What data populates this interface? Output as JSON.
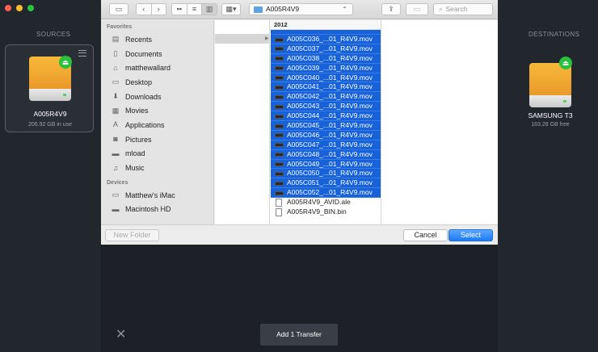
{
  "sources": {
    "title": "SOURCES",
    "volume": {
      "name": "A005R4V9",
      "size": "206.92 GB in use"
    }
  },
  "destinations": {
    "title": "DESTINATIONS",
    "volume": {
      "name": "SAMSUNG T3",
      "size": "163.28 GB free"
    }
  },
  "dialog": {
    "path": "A005R4V9",
    "search_placeholder": "Search",
    "sidebar": {
      "favorites_header": "Favorites",
      "favorites": [
        {
          "label": "Recents",
          "icon": "recents-icon"
        },
        {
          "label": "Documents",
          "icon": "documents-icon"
        },
        {
          "label": "matthewallard",
          "icon": "home-icon"
        },
        {
          "label": "Desktop",
          "icon": "desktop-icon"
        },
        {
          "label": "Downloads",
          "icon": "downloads-icon"
        },
        {
          "label": "Movies",
          "icon": "movies-icon"
        },
        {
          "label": "Applications",
          "icon": "applications-icon"
        },
        {
          "label": "Pictures",
          "icon": "pictures-icon"
        },
        {
          "label": "mload",
          "icon": "folder-icon"
        },
        {
          "label": "Music",
          "icon": "music-icon"
        }
      ],
      "devices_header": "Devices",
      "devices": [
        {
          "label": "Matthew's iMac",
          "icon": "imac-icon"
        },
        {
          "label": "Macintosh HD",
          "icon": "disk-icon"
        }
      ]
    },
    "column_header": "2012",
    "files_selected": [
      "A005C036_...01_R4V9.mov",
      "A005C037_...01_R4V9.mov",
      "A005C038_...01_R4V9.mov",
      "A005C039_...01_R4V9.mov",
      "A005C040_...01_R4V9.mov",
      "A005C041_...01_R4V9.mov",
      "A005C042_...01_R4V9.mov",
      "A005C043_...01_R4V9.mov",
      "A005C044_...01_R4V9.mov",
      "A005C045_...01_R4V9.mov",
      "A005C046_...01_R4V9.mov",
      "A005C047_...01_R4V9.mov",
      "A005C048_...01_R4V9.mov",
      "A005C049_...01_R4V9.mov",
      "A005C050_...01_R4V9.mov",
      "A005C051_...01_R4V9.mov",
      "A005C052_...01_R4V9.mov"
    ],
    "files_other": [
      "A005R4V9_AVID.ale",
      "A005R4V9_BIN.bin"
    ],
    "buttons": {
      "new_folder": "New Folder",
      "cancel": "Cancel",
      "select": "Select"
    }
  },
  "bottom": {
    "add_transfer": "Add 1 Transfer",
    "close_glyph": "✕"
  },
  "colors": {
    "selection": "#1762d9",
    "background": "#22262d",
    "accent_green": "#27c13b"
  }
}
